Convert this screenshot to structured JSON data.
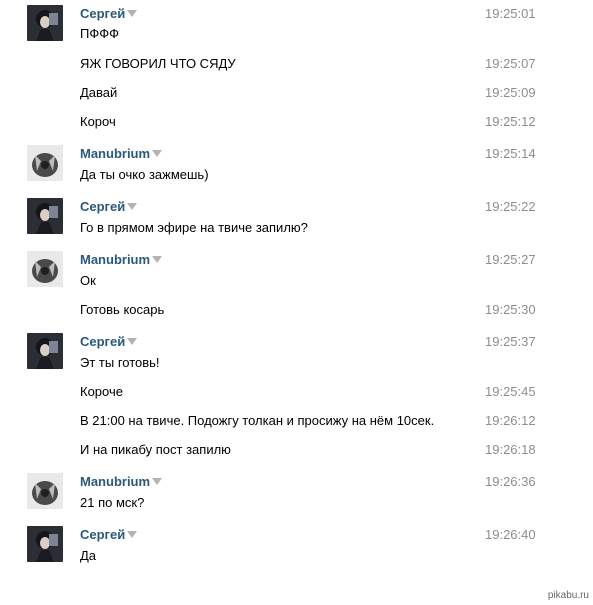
{
  "messages": [
    {
      "author": "Сергей",
      "text": "ПФФФ",
      "time": "19:25:01"
    },
    {
      "text": "ЯЖ ГОВОРИЛ ЧТО СЯДУ",
      "time": "19:25:07"
    },
    {
      "text": "Давай",
      "time": "19:25:09"
    },
    {
      "text": "Короч",
      "time": "19:25:12"
    },
    {
      "author": "Manubrium",
      "text": "Да ты очко зажмешь)",
      "time": "19:25:14"
    },
    {
      "author": "Сергей",
      "text": "Го в прямом эфире на твиче запилю?",
      "time": "19:25:22"
    },
    {
      "author": "Manubrium",
      "text": "Ок",
      "time": "19:25:27"
    },
    {
      "text": "Готовь косарь",
      "time": "19:25:30"
    },
    {
      "author": "Сергей",
      "text": "Эт ты готовь!",
      "time": "19:25:37"
    },
    {
      "text": "Короче",
      "time": "19:25:45"
    },
    {
      "text": "В 21:00 на твиче. Подожгу толкан и просижу на нём 10сек.",
      "time": "19:26:12"
    },
    {
      "text": "И на пикабу пост запилю",
      "time": "19:26:18"
    },
    {
      "author": "Manubrium",
      "text": "21 по мск?",
      "time": "19:26:36"
    },
    {
      "author": "Сергей",
      "text": "Да",
      "time": "19:26:40"
    }
  ],
  "watermark": "pikabu.ru"
}
